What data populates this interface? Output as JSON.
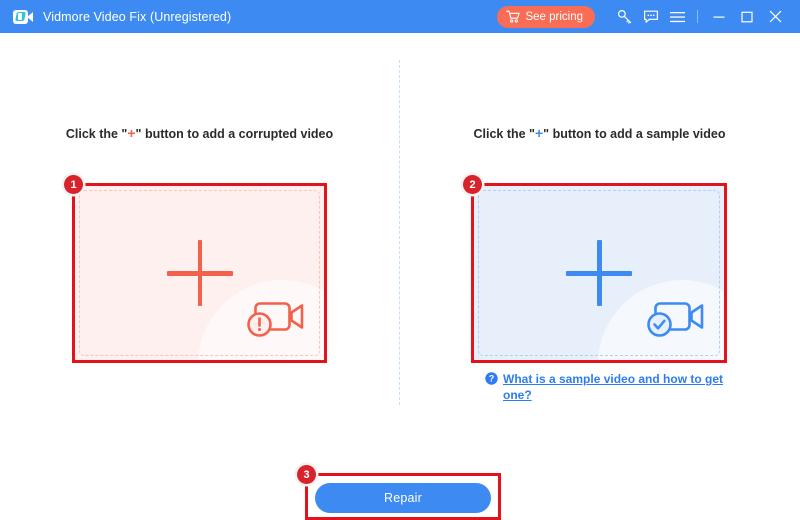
{
  "titlebar": {
    "app_title": "Vidmore Video Fix (Unregistered)",
    "logo_icon": "video-camera-logo-icon",
    "pricing_label": "See pricing",
    "pricing_icon": "shopping-cart-icon",
    "pricing_bg": "#f96c55",
    "bar_bg": "#3d8bf2",
    "icons": [
      {
        "name": "register-key-icon",
        "glyph": "key"
      },
      {
        "name": "feedback-chat-icon",
        "glyph": "chat"
      },
      {
        "name": "menu-hamburger-icon",
        "glyph": "menu"
      }
    ],
    "window_controls": [
      {
        "name": "minimize-button",
        "glyph": "minimize"
      },
      {
        "name": "maximize-button",
        "glyph": "maximize"
      },
      {
        "name": "close-button",
        "glyph": "close"
      }
    ]
  },
  "left_panel": {
    "caption_before": "Click the \"",
    "caption_plus": "+",
    "caption_after": "\" button to add a corrupted video",
    "step_number": "1",
    "dropzone_name": "corrupted-video-dropzone",
    "plus_icon": "plus-icon",
    "camera_icon": "video-camera-error-icon",
    "accent": "#f2614c",
    "bg": "#fdf0ee"
  },
  "right_panel": {
    "caption_before": "Click the \"",
    "caption_plus": "+",
    "caption_after": "\" button to add a sample video",
    "step_number": "2",
    "dropzone_name": "sample-video-dropzone",
    "plus_icon": "plus-icon",
    "camera_icon": "video-camera-verified-icon",
    "accent": "#3d8bf2",
    "bg": "#e7effb",
    "help_link": "What is a sample video and how to get one?",
    "help_icon": "question-circle-icon"
  },
  "action": {
    "step_number": "3",
    "repair_label": "Repair",
    "repair_bg": "#3d8bf2"
  },
  "annotation": {
    "box_color": "#e2141b",
    "badge_color": "#d8232a"
  }
}
